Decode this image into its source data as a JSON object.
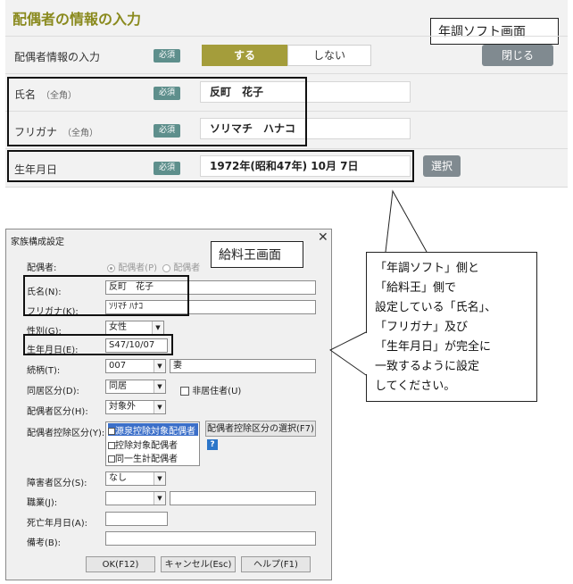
{
  "top": {
    "title": "配偶者の情報の入力",
    "tag": "年調ソフト画面",
    "required": "必須",
    "spouse_input": {
      "label": "配偶者情報の入力",
      "yes": "する",
      "no": "しない"
    },
    "close_button": "閉じる",
    "name": {
      "label": "氏名",
      "sub": "（全角）",
      "value": "反町　花子"
    },
    "furigana": {
      "label": "フリガナ",
      "sub": "（全角）",
      "value": "ソリマチ　ハナコ"
    },
    "birthdate": {
      "label": "生年月日",
      "value": "1972年(昭和47年) 10月 7日"
    },
    "select_button": "選択"
  },
  "dialog": {
    "title": "家族構成設定",
    "tag": "給料王画面",
    "spouse": {
      "label": "配偶者:",
      "opt1": "配偶者(P)",
      "opt2": "配偶者"
    },
    "name": {
      "label": "氏名(N):",
      "value": "反町　花子"
    },
    "furigana": {
      "label": "フリガナ(K):",
      "value": "ｿﾘﾏﾁ ﾊﾅｺ"
    },
    "gender": {
      "label": "性別(G):",
      "value": "女性"
    },
    "birthdate": {
      "label": "生年月日(E):",
      "value": "S47/10/07"
    },
    "relation": {
      "label": "続柄(T):",
      "code": "007",
      "value": "妻"
    },
    "cohabit": {
      "label": "同居区分(D):",
      "value": "同居",
      "nonresident": "非居住者(U)"
    },
    "spouse_class": {
      "label": "配偶者区分(H):",
      "value": "対象外"
    },
    "deduction": {
      "label": "配偶者控除区分(Y):",
      "options": [
        "源泉控除対象配偶者",
        "控除対象配偶者",
        "同一生計配偶者"
      ],
      "select_button": "配偶者控除区分の選択(F7)",
      "help": "?"
    },
    "disability": {
      "label": "障害者区分(S):",
      "value": "なし"
    },
    "job": {
      "label": "職業(J):"
    },
    "death_date": {
      "label": "死亡年月日(A):"
    },
    "note": {
      "label": "備考(B):"
    },
    "buttons": {
      "ok": "OK(F12)",
      "cancel": "キャンセル(Esc)",
      "help": "ヘルプ(F1)"
    },
    "close": "✕"
  },
  "callout": {
    "lines": [
      "「年調ソフト」側と",
      "「給料王」側で",
      "設定している「氏名」、",
      "「フリガナ」及び",
      "「生年月日」が完全に",
      "一致するように設定",
      "してください。"
    ]
  }
}
